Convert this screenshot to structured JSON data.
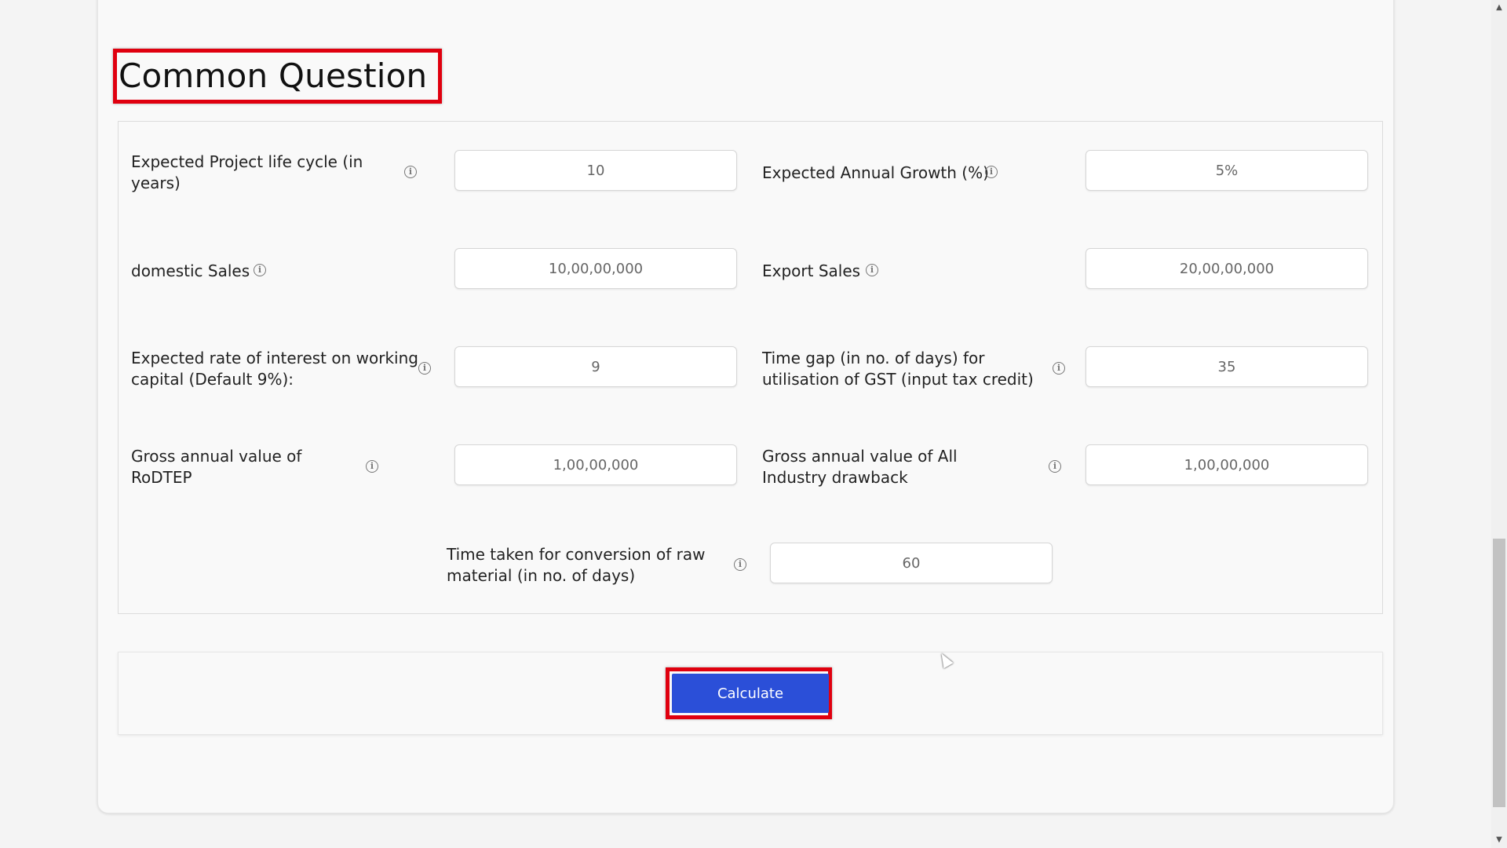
{
  "section": {
    "title": "Common Question"
  },
  "questions": [
    {
      "label": "Expected Project life cycle (in years)",
      "value": "10"
    },
    {
      "label": "Expected Annual Growth (%)",
      "value": "5%"
    },
    {
      "label": "domestic Sales",
      "value": "10,00,00,000"
    },
    {
      "label": "Export Sales",
      "value": "20,00,00,000"
    },
    {
      "label": "Expected rate of interest on working capital (Default 9%):",
      "value": "9"
    },
    {
      "label": "Time gap (in no. of days) for utilisation of GST (input tax credit)",
      "value": "35"
    },
    {
      "label": "Gross annual value of RoDTEP",
      "value": "1,00,00,000"
    },
    {
      "label": "Gross annual value of All Industry drawback",
      "value": "1,00,00,000"
    },
    {
      "label": "Time taken for conversion of raw material (in no. of days)",
      "value": "60"
    }
  ],
  "actions": {
    "calculate_label": "Calculate"
  },
  "colors": {
    "highlight": "#e0000f",
    "primary_button": "#2b4fd8"
  },
  "icons": {
    "info": "info-circle-icon"
  },
  "scrollbar": {
    "up": "▲",
    "down": "▼"
  }
}
